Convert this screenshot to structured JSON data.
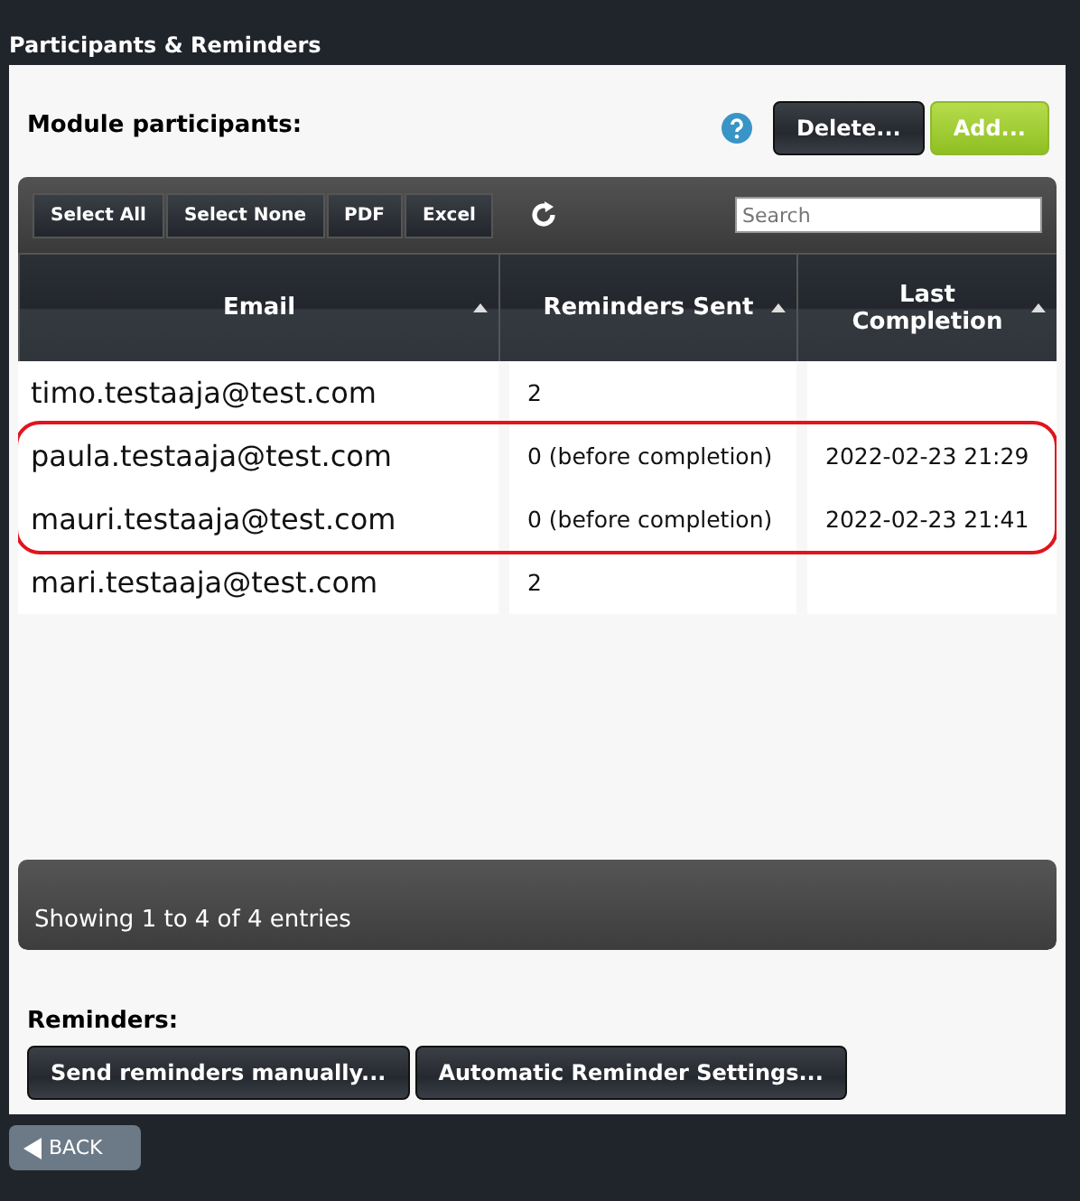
{
  "window": {
    "title": "Participants & Reminders"
  },
  "section_title": "Module participants:",
  "header_buttons": [
    {
      "label": "Delete...",
      "kind": "dark"
    },
    {
      "label": "Add...",
      "kind": "green"
    }
  ],
  "toolbar": {
    "buttons": [
      "Select All",
      "Select None",
      "PDF",
      "Excel"
    ],
    "search": {
      "placeholder": "Search"
    }
  },
  "table": {
    "columns": [
      "Email",
      "Reminders Sent",
      "Last Completion"
    ],
    "rows": [
      {
        "cells": [
          "timo.testaaja@test.com",
          "2",
          ""
        ],
        "highlighted": false
      },
      {
        "cells": [
          "paula.testaaja@test.com",
          "0 (before completion)",
          "2022-02-23 21:29"
        ],
        "highlighted": true
      },
      {
        "cells": [
          "mauri.testaaja@test.com",
          "0 (before completion)",
          "2022-02-23 21:41"
        ],
        "highlighted": true
      },
      {
        "cells": [
          "mari.testaaja@test.com",
          "2",
          ""
        ],
        "highlighted": false
      }
    ],
    "footer": "Showing 1 to 4 of 4 entries"
  },
  "reminders": {
    "title": "Reminders:",
    "buttons": [
      "Send reminders manually...",
      "Automatic Reminder Settings..."
    ]
  },
  "back_button": "BACK"
}
